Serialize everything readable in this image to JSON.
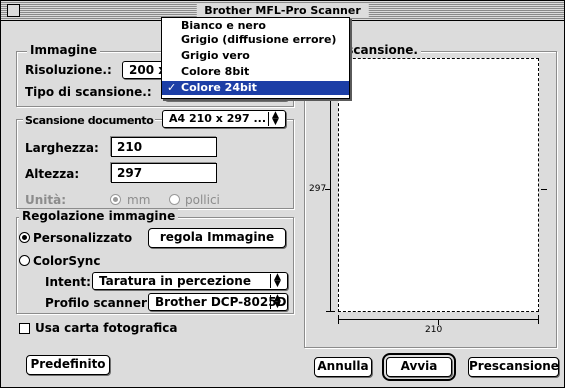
{
  "window": {
    "title": "Brother MFL-Pro Scanner"
  },
  "image_group": {
    "title": "Immagine",
    "resolution_label": "Risoluzione.:",
    "resolution_value": "200 x",
    "scan_type_label": "Tipo di scansione.:"
  },
  "scan_type_menu": {
    "items": [
      {
        "label": "Bianco e nero",
        "selected": false
      },
      {
        "label": "Grigio (diffusione errore)",
        "selected": false
      },
      {
        "label": "Grigio vero",
        "selected": false
      },
      {
        "label": "Colore 8bit",
        "selected": false
      },
      {
        "label": "Colore 24bit",
        "selected": true
      }
    ],
    "check_glyph": "✓"
  },
  "document_group": {
    "title": "Scansione documento",
    "size_value": "A4 210 x 297 ...",
    "width_label": "Larghezza:",
    "width_value": "210",
    "height_label": "Altezza:",
    "height_value": "297",
    "unit_label": "Unità:",
    "unit_mm": "mm",
    "unit_inch": "pollici"
  },
  "adjust_group": {
    "title": "Regolazione immagine",
    "custom_label": "Personalizzato",
    "adjust_button": "regola Immagine",
    "colorsync_label": "ColorSync",
    "intent_label": "Intent:",
    "intent_value": "Taratura in percezione",
    "profile_label": "Profilo scanner:",
    "profile_value": "Brother DCP-8025D"
  },
  "photo_paper_label": "Usa carta fotografica",
  "preview": {
    "title": "i scansione.",
    "height_label": "297",
    "width_label": "210"
  },
  "buttons": {
    "default": "Predefinito",
    "cancel": "Annulla",
    "start": "Avvia",
    "prescan": "Prescansione"
  },
  "colors": {
    "menu_highlight": "#1c3ea6",
    "window_bg": "#dcdcdc"
  }
}
